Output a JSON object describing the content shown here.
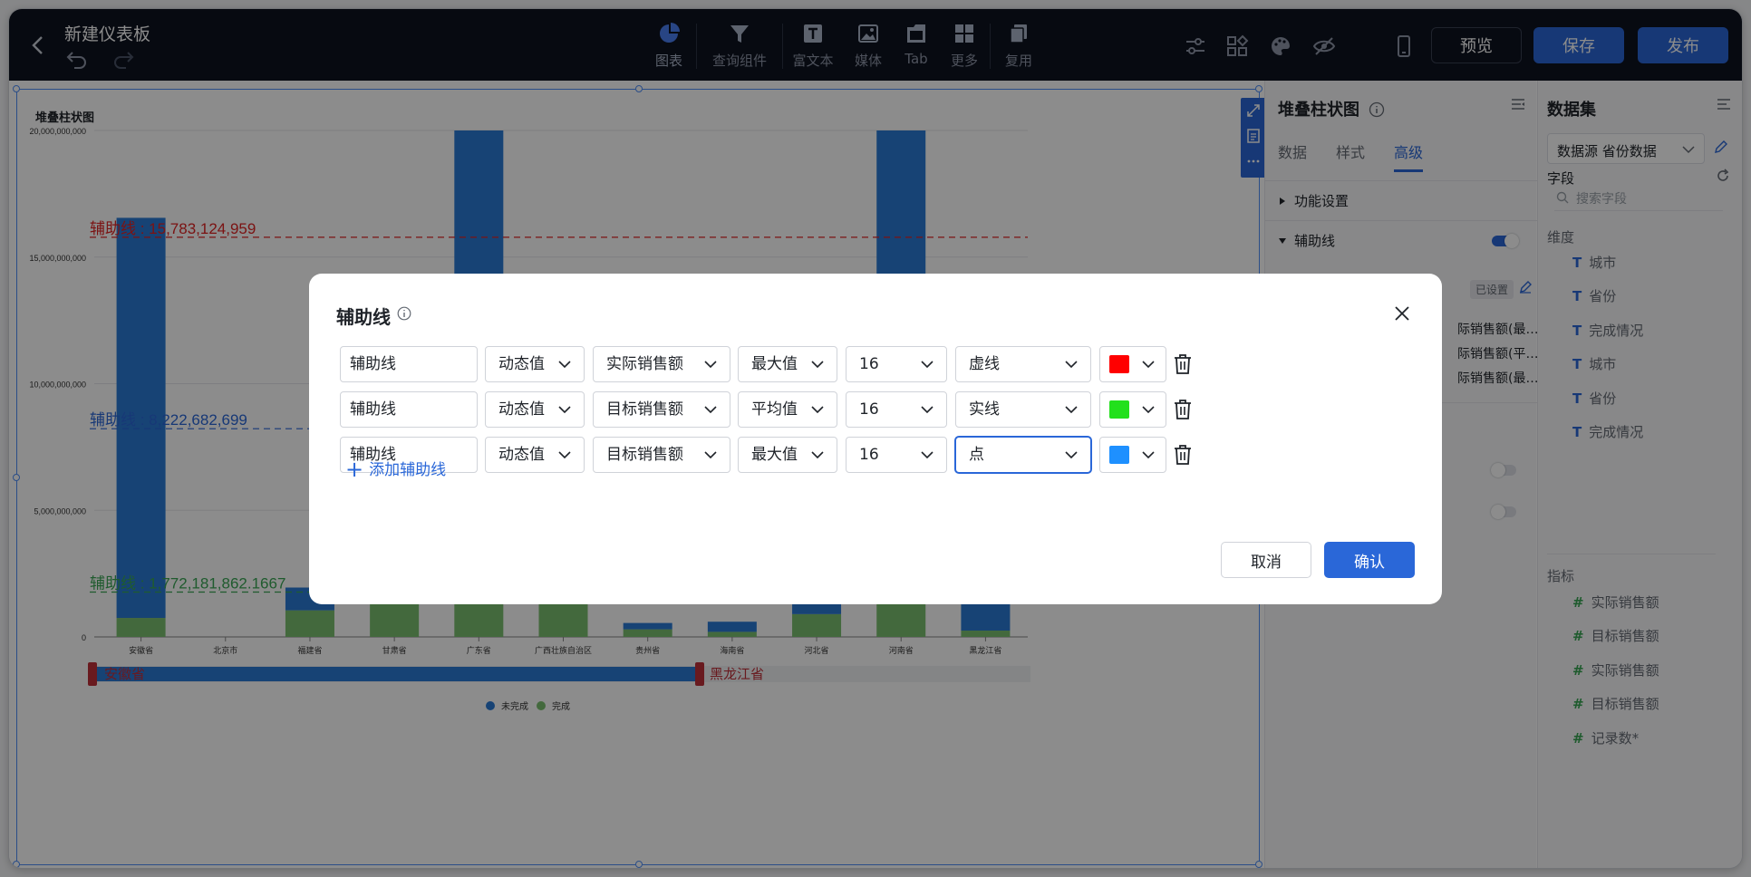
{
  "topbar": {
    "title": "新建仪表板",
    "tools": [
      {
        "label": "图表",
        "icon": "pie-chart-icon"
      },
      {
        "label": "查询组件",
        "icon": "filter-icon"
      },
      {
        "label": "富文本",
        "icon": "text-icon"
      },
      {
        "label": "媒体",
        "icon": "image-icon"
      },
      {
        "label": "Tab",
        "icon": "tab-icon"
      },
      {
        "label": "更多",
        "icon": "grid-icon"
      },
      {
        "label": "复用",
        "icon": "copy-icon"
      }
    ],
    "preview_label": "预览",
    "save_label": "保存",
    "publish_label": "发布"
  },
  "chart": {
    "title": "堆叠柱状图",
    "range_start": "安徽省",
    "range_end": "黑龙江省",
    "legend": [
      "未完成",
      "完成"
    ]
  },
  "chart_data": {
    "type": "bar",
    "stacked": true,
    "categories": [
      "安徽省",
      "北京市",
      "福建省",
      "甘肃省",
      "广东省",
      "广西壮族自治区",
      "贵州省",
      "海南省",
      "河北省",
      "河南省",
      "黑龙江省"
    ],
    "series": [
      {
        "name": "完成",
        "color": "#7ac06f",
        "values": [
          750000000,
          0,
          1050000000,
          3500000000,
          5600000000,
          3700000000,
          300000000,
          200000000,
          900000000,
          2000000000,
          250000000
        ]
      },
      {
        "name": "未完成",
        "color": "#2b7bd6",
        "values": [
          15800000000,
          0,
          900000000,
          450000000,
          30800000000,
          300000000,
          250000000,
          400000000,
          650000000,
          28100000000,
          7200000000
        ]
      }
    ],
    "yticks": [
      "0",
      "5,000,000,000",
      "10,000,000,000",
      "15,000,000,000",
      "20,000,000,000"
    ],
    "ylim": [
      0,
      20000000000
    ],
    "reference_lines": [
      {
        "label": "辅助线 : 15,783,124,959",
        "value": 15783124959,
        "color": "#e02424",
        "style": "dashed"
      },
      {
        "label": "辅助线 : 8,222,682,699",
        "value": 8222682699,
        "color": "#2a67d8",
        "style": "dashed"
      },
      {
        "label": "辅助线 : 1,772,181,862.1667",
        "value": 1772181862.1667,
        "color": "#3aa655",
        "style": "dashed"
      }
    ],
    "grid": true,
    "legend_position": "bottom"
  },
  "props": {
    "title": "堆叠柱状图",
    "tabs": [
      {
        "label": "数据"
      },
      {
        "label": "样式"
      },
      {
        "label": "高级",
        "active": true
      }
    ],
    "sections": [
      {
        "label": "功能设置"
      },
      {
        "label": "辅助线"
      }
    ],
    "set_badge": "已设置",
    "peek_lines": [
      "际销售额(最…",
      "际销售额(平…",
      "际销售额(最…"
    ]
  },
  "dataset": {
    "title": "数据集",
    "source": "数据源 省份数据",
    "fields_label": "字段",
    "search_placeholder": "搜索字段",
    "dimensions_label": "维度",
    "dimensions": [
      "城市",
      "省份",
      "完成情况",
      "城市",
      "省份",
      "完成情况"
    ],
    "measures_label": "指标",
    "measures": [
      "实际销售额",
      "目标销售额",
      "实际销售额",
      "目标销售额",
      "记录数*"
    ]
  },
  "dialog": {
    "title": "辅助线",
    "rows": [
      {
        "name": "辅助线",
        "type": "动态值",
        "field": "实际销售额",
        "agg": "最大值",
        "font_size": "16",
        "line": "虚线",
        "color": "#ff0000"
      },
      {
        "name": "辅助线",
        "type": "动态值",
        "field": "目标销售额",
        "agg": "平均值",
        "font_size": "16",
        "line": "实线",
        "color": "#22e01c"
      },
      {
        "name": "辅助线",
        "type": "动态值",
        "field": "目标销售额",
        "agg": "最大值",
        "font_size": "16",
        "line": "点",
        "color": "#1e90ff"
      }
    ],
    "add_label": "添加辅助线",
    "cancel_label": "取消",
    "confirm_label": "确认"
  }
}
